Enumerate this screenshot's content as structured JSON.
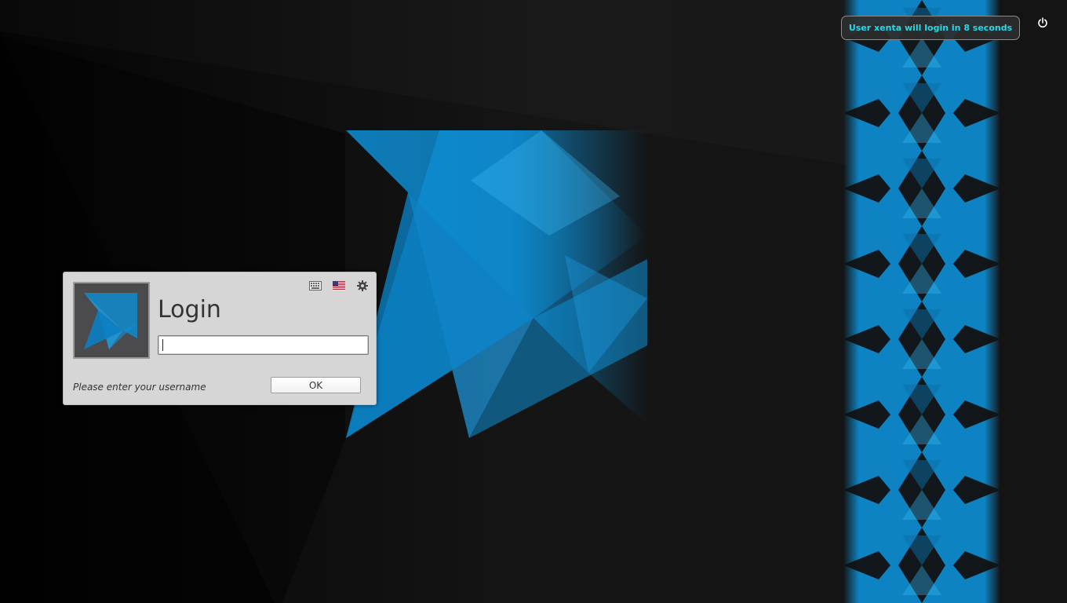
{
  "autologin": {
    "message": "User xenta will login in 8 seconds"
  },
  "system": {
    "power_icon": "power-icon"
  },
  "login": {
    "title": "Login",
    "username_value": "",
    "prompt": "Please enter your username",
    "ok_label": "OK",
    "icons": [
      "keyboard-icon",
      "us-flag-icon",
      "gear-icon"
    ]
  },
  "colors": {
    "accent": "#0d8fd6",
    "message_text": "#29d8e6",
    "panel_bg": "#d6d6d6"
  }
}
